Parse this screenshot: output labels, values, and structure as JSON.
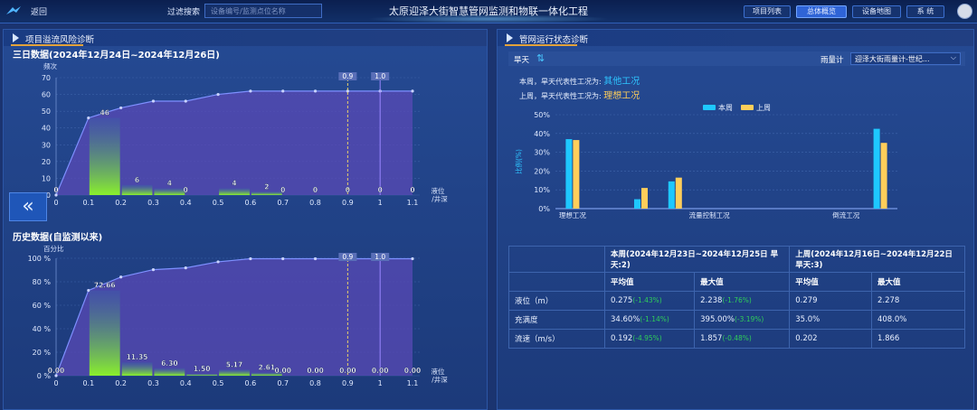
{
  "topbar": {
    "back_label": "返回",
    "filter_label": "过滤搜索",
    "filter_placeholder": "设备编号/监测点位名称",
    "app_title": "太原迎泽大街智慧管网监测和物联一体化工程",
    "nav": [
      {
        "label": "项目列表",
        "active": false
      },
      {
        "label": "总体概览",
        "active": true
      },
      {
        "label": "设备地图",
        "active": false
      },
      {
        "label": "系 统",
        "active": false
      }
    ]
  },
  "left_panel": {
    "title": "项目溢流风险诊断",
    "three_day_title": "三日数据(2024年12月24日~2024年12月26日)",
    "history_title": "历史数据(自监测以来)",
    "collapse_icon_label": "«"
  },
  "right_panel": {
    "title": "管网运行状态诊断",
    "status_label": "旱天",
    "rain_gauge_label": "雨量计",
    "rain_gauge_value": "迎泽大街雨量计-世纪...",
    "this_week_condition_label": "本周，旱天代表性工况为:",
    "this_week_condition_value": "其他工况",
    "last_week_condition_label": "上周，旱天代表性工况为:",
    "last_week_condition_value": "理想工况",
    "table": {
      "col_header_this": "本周(2024年12月23日~2024年12月25日 旱天:2)",
      "col_header_last": "上周(2024年12月16日~2024年12月22日 旱天:3)",
      "sub_headers": [
        "平均值",
        "最大值",
        "平均值",
        "最大值"
      ],
      "rows": [
        {
          "name": "液位（m）",
          "cells": [
            "0.275",
            "2.238",
            "0.279",
            "2.278"
          ],
          "pcts": [
            "(-1.43%)",
            "(-1.76%)"
          ]
        },
        {
          "name": "充满度",
          "cells": [
            "34.60%",
            "395.00%",
            "35.0%",
            "408.0%"
          ],
          "pcts": [
            "(-1.14%)",
            "(-3.19%)"
          ]
        },
        {
          "name": "流速（m/s）",
          "cells": [
            "0.192",
            "1.857",
            "0.202",
            "1.866"
          ],
          "pcts": [
            "(-4.95%)",
            "(-0.48%)"
          ]
        }
      ]
    }
  },
  "colors": {
    "bar_green": "#8af02c",
    "line": "#7e90ff",
    "area": "#5a4ab5",
    "this_week": "#1ec8ff",
    "last_week": "#ffce5a",
    "threshold": "#e7d06a"
  },
  "chart_data": [
    {
      "type": "bar",
      "title": "三日数据(2024年12月24日~2024年12月26日)",
      "ylabel": "频次",
      "xlabel": "液位/井深",
      "ylim": [
        0,
        70
      ],
      "yticks": [
        0,
        10,
        20,
        30,
        40,
        50,
        60,
        70
      ],
      "x": [
        0,
        0.1,
        0.2,
        0.3,
        0.4,
        0.5,
        0.6,
        0.7,
        0.8,
        0.9,
        1,
        1.1
      ],
      "bars": [
        0,
        46,
        6,
        4,
        0,
        4,
        2,
        0,
        0,
        0,
        0,
        0
      ],
      "bar_labels": [
        "0",
        "46",
        "6",
        "4",
        "0",
        "4",
        "2",
        "0",
        "0",
        "0",
        "0",
        "0"
      ],
      "cumulative": [
        0,
        46,
        52,
        56,
        56,
        60,
        62,
        62,
        62,
        62,
        62,
        62
      ],
      "markers": [
        {
          "x": 0.9,
          "label": "0.9"
        },
        {
          "x": 1,
          "label": "1.0"
        }
      ],
      "grid": true
    },
    {
      "type": "bar",
      "title": "历史数据(自监测以来)",
      "ylabel": "百分比",
      "xlabel": "液位/井深",
      "ylim": [
        0,
        100
      ],
      "yticks": [
        0,
        20,
        40,
        60,
        80,
        100
      ],
      "ytick_labels": [
        "0 %",
        "20 %",
        "40 %",
        "60 %",
        "80 %",
        "100 %"
      ],
      "x": [
        0,
        0.1,
        0.2,
        0.3,
        0.4,
        0.5,
        0.6,
        0.7,
        0.8,
        0.9,
        1,
        1.1
      ],
      "bars": [
        0,
        72.66,
        11.35,
        6.3,
        1.5,
        5.17,
        2.61,
        0,
        0,
        0,
        0,
        0
      ],
      "bar_labels": [
        "0.00",
        "72.66",
        "11.35",
        "6.30",
        "1.50",
        "5.17",
        "2.61",
        "0.00",
        "0.00",
        "0.00",
        "0.00",
        "0.00"
      ],
      "cumulative": [
        0,
        72.66,
        84.01,
        90.31,
        91.81,
        96.98,
        99.59,
        99.6,
        99.6,
        99.6,
        99.6,
        99.6
      ],
      "markers": [
        {
          "x": 0.9,
          "label": "0.9"
        },
        {
          "x": 1,
          "label": "1.0"
        }
      ],
      "grid": true
    },
    {
      "type": "bar",
      "ylabel": "比例(%)",
      "ylim": [
        0,
        50
      ],
      "yticks": [
        0,
        10,
        20,
        30,
        40,
        50
      ],
      "ytick_labels": [
        "0%",
        "10%",
        "20%",
        "30%",
        "40%",
        "50%"
      ],
      "categories": [
        "理想工况",
        "流量控制工况",
        "倒流工况"
      ],
      "category_positions": [
        0.5,
        4.5,
        8.5
      ],
      "group_x": [
        0.5,
        1.5,
        2.5,
        3.5,
        4.5,
        5.5,
        6.5,
        7.5,
        8.5,
        9.5
      ],
      "legend": "top-center",
      "series": [
        {
          "name": "本周",
          "values": [
            37,
            0,
            5,
            14.5,
            0,
            0,
            0,
            0,
            0,
            42.5
          ]
        },
        {
          "name": "上周",
          "values": [
            36.5,
            0,
            11,
            16.5,
            0,
            0,
            0,
            0,
            0,
            35
          ]
        }
      ]
    }
  ]
}
